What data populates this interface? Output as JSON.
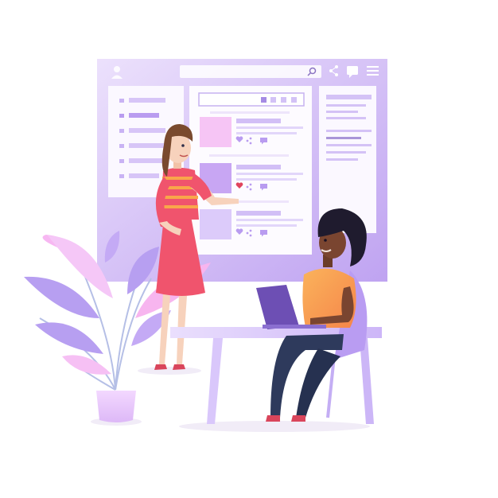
{
  "colors": {
    "background": "#ffffff",
    "board_gradient_start": "#e9dcfb",
    "board_gradient_end": "#bfa4f0",
    "panel": "#fbf7ff",
    "bar_light": "#d8c6f7",
    "bar_dark": "#b597ee",
    "thumb_pink": "#f6c5f5",
    "thumb_violet": "#c8a6f3",
    "heart_active": "#e0445d",
    "leaf_pink": "#f7b9f2",
    "leaf_violet": "#b99cf2",
    "desk": "#d9c7fb",
    "skin_light": "#f7d2bc",
    "skin_dark": "#7a4530",
    "dress": "#f0546d",
    "top_orange": "#f9a64a",
    "jeans": "#2e3a5c",
    "laptop": "#6d4fb4"
  },
  "icons": {
    "user": "user-icon",
    "search": "search-icon",
    "share": "share-icon",
    "chat": "chat-icon",
    "menu": "menu-icon",
    "heart": "heart-icon"
  },
  "feed_posts": [
    {
      "liked": false
    },
    {
      "liked": true
    },
    {
      "liked": false
    }
  ]
}
